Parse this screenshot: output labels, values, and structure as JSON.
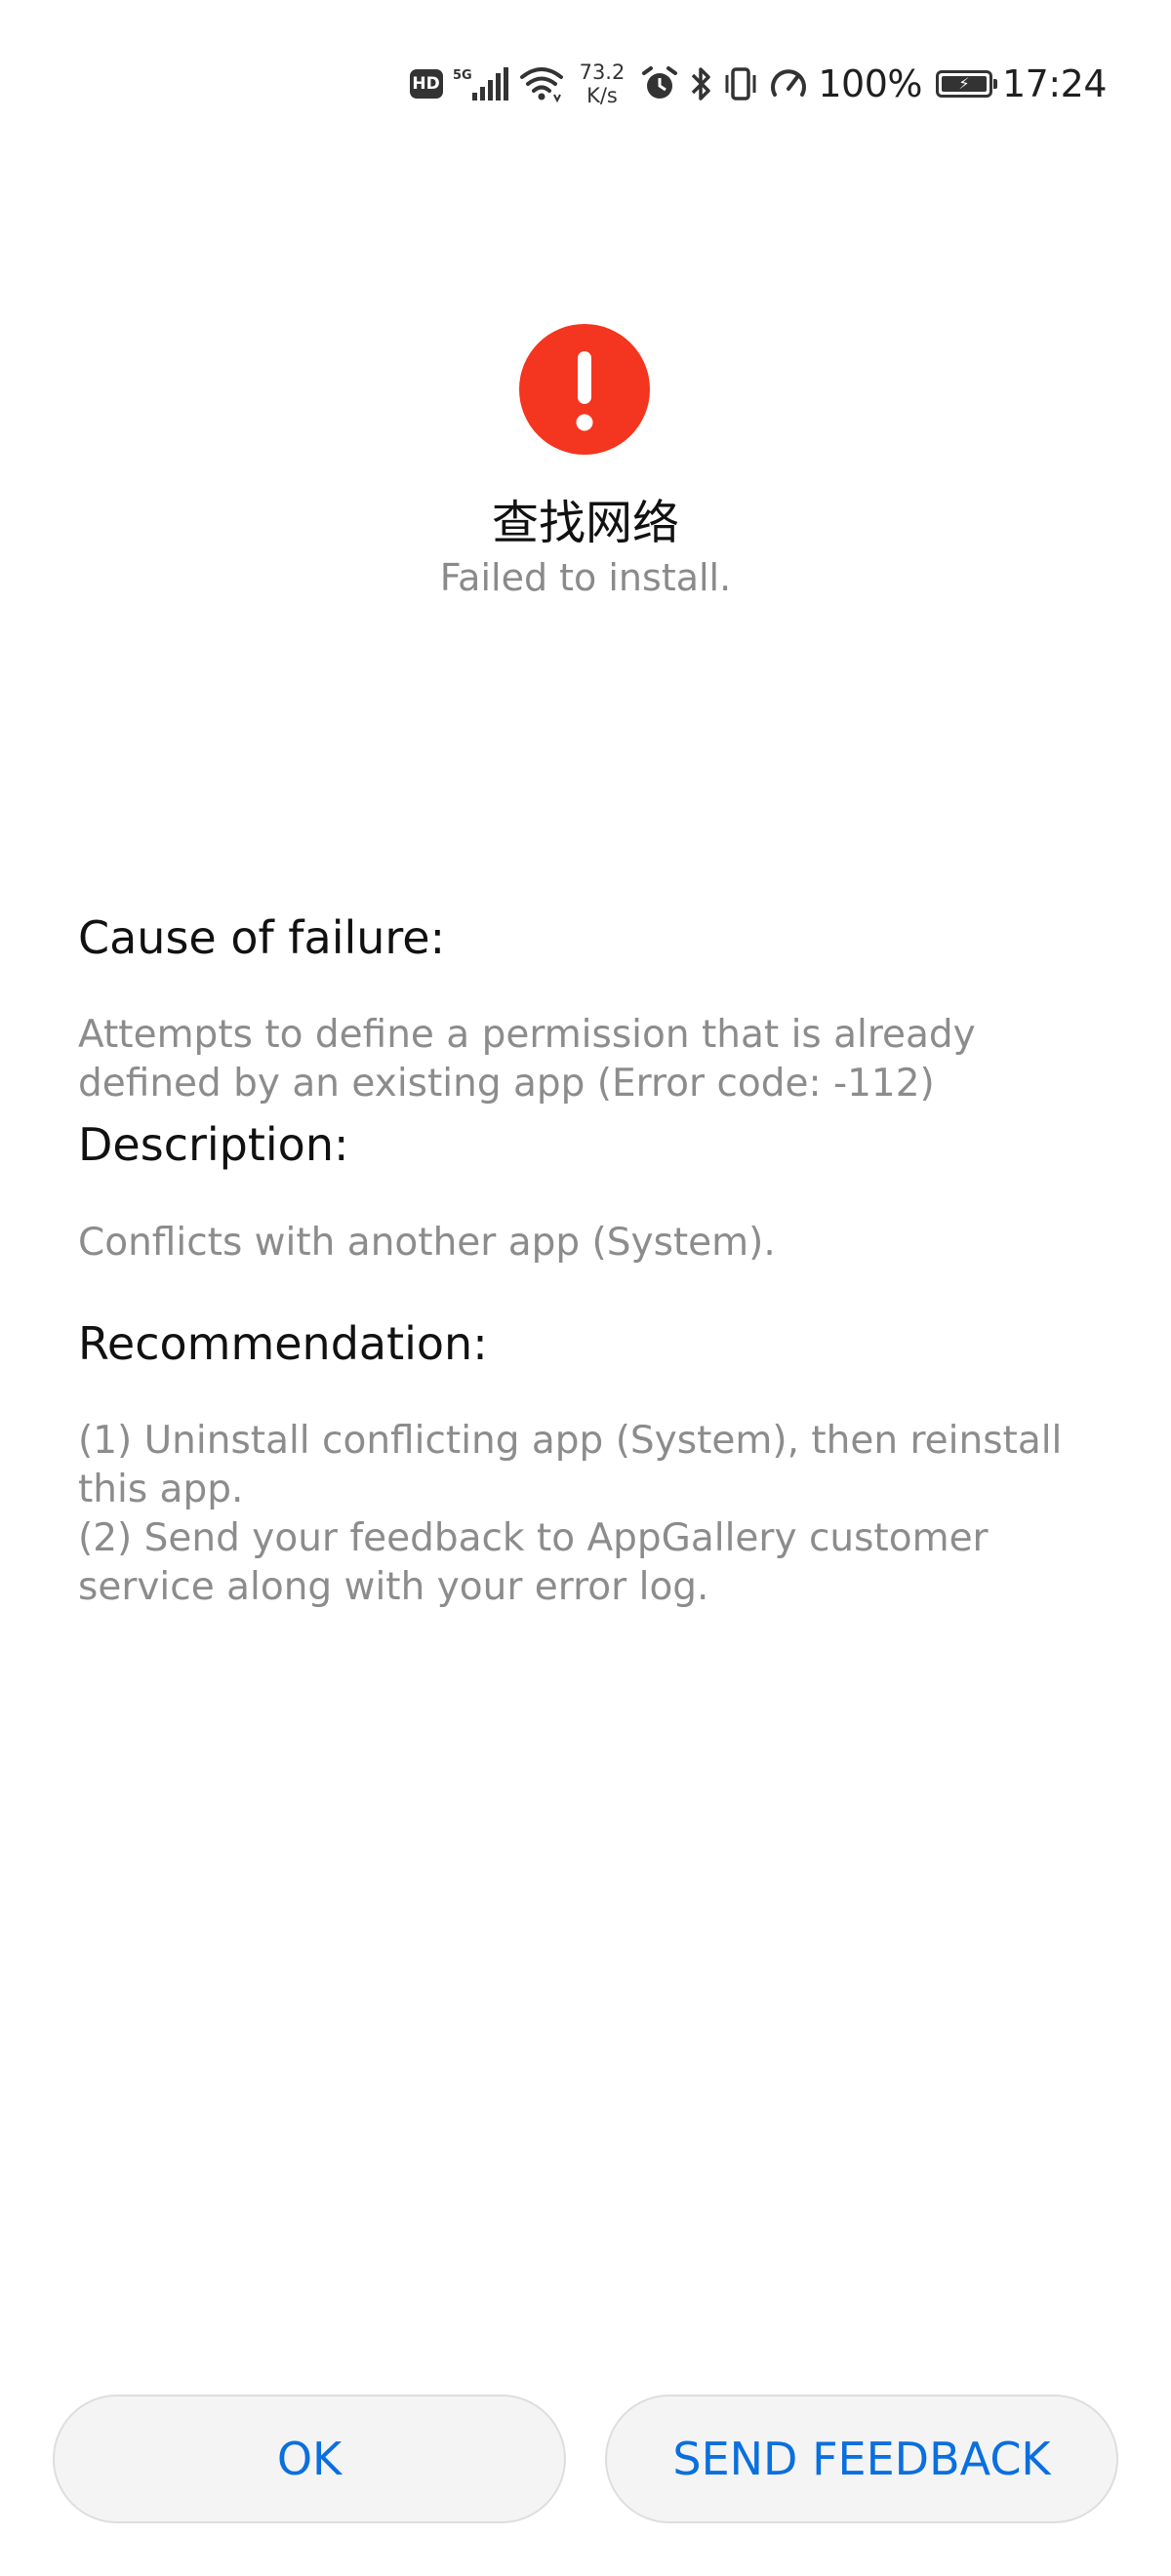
{
  "status_bar": {
    "hd_label": "HD",
    "network_type": "5G",
    "net_speed_value": "73.2",
    "net_speed_unit": "K/s",
    "battery_percent": "100%",
    "battery_level": 1.0,
    "time": "17:24",
    "icons": [
      "hd-icon",
      "5g-signal-icon",
      "wifi-icon",
      "alarm-icon",
      "bluetooth-icon",
      "vibrate-icon",
      "speedometer-icon",
      "battery-charging-icon"
    ]
  },
  "header": {
    "icon": "error-exclamation-icon",
    "icon_color": "#f4351f",
    "app_name": "查找网络",
    "status_text": "Failed to install."
  },
  "sections": {
    "cause": {
      "heading": "Cause of failure:",
      "body": "Attempts to define a permission that is already defined by an existing app (Error code: -112)"
    },
    "description": {
      "heading": "Description:",
      "body": "Conflicts with another app (System)."
    },
    "recommendation": {
      "heading": "Recommendation:",
      "items": [
        "(1) Uninstall conflicting app (System), then reinstall this app.",
        "(2) Send your feedback to AppGallery customer service along with your error log."
      ]
    }
  },
  "buttons": {
    "ok_label": "OK",
    "feedback_label": "SEND FEEDBACK",
    "accent_color": "#0a6fdf"
  }
}
